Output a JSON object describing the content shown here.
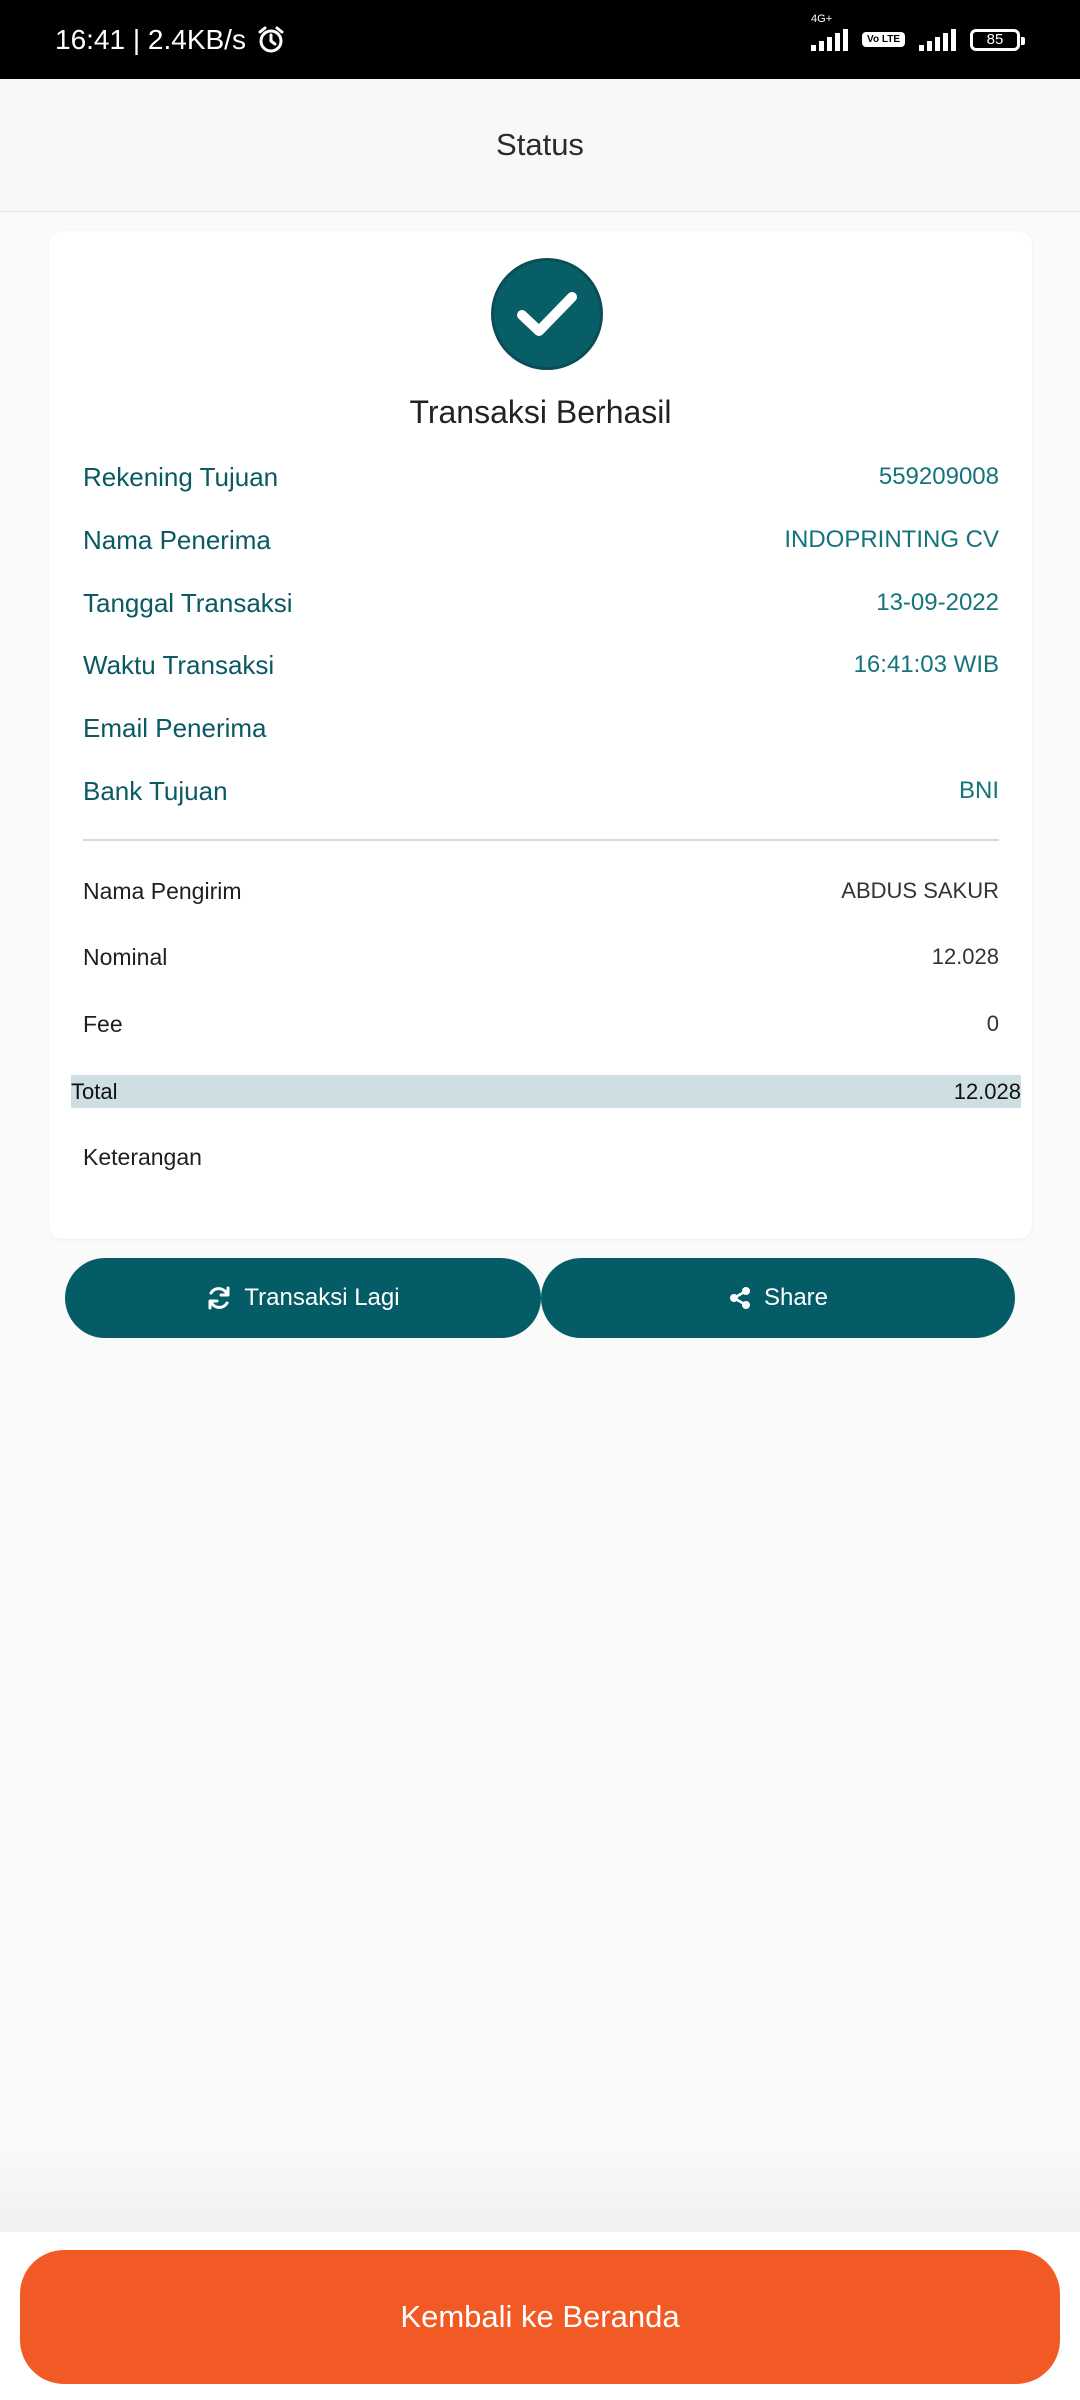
{
  "status_bar": {
    "time_speed": "16:41 | 2.4KB/s",
    "network_tiny": "4G+",
    "volte": "Vo LTE",
    "battery": "85"
  },
  "header": {
    "title": "Status"
  },
  "result": {
    "title": "Transaksi Berhasil",
    "details": [
      {
        "label": "Rekening Tujuan",
        "value": "559209008"
      },
      {
        "label": "Nama Penerima",
        "value": "INDOPRINTING CV"
      },
      {
        "label": "Tanggal Transaksi",
        "value": "13-09-2022"
      },
      {
        "label": "Waktu Transaksi",
        "value": "16:41:03 WIB"
      },
      {
        "label": "Email Penerima",
        "value": ""
      },
      {
        "label": "Bank Tujuan",
        "value": "BNI"
      }
    ],
    "summary": [
      {
        "label": "Nama Pengirim",
        "value": "ABDUS SAKUR"
      },
      {
        "label": "Nominal",
        "value": "12.028"
      },
      {
        "label": "Fee",
        "value": "0"
      },
      {
        "label": "Total",
        "value": "12.028"
      },
      {
        "label": "Keterangan",
        "value": ""
      }
    ]
  },
  "actions": {
    "retry_label": "Transaksi Lagi",
    "share_label": "Share"
  },
  "footer": {
    "home_label": "Kembali ke Beranda"
  },
  "colors": {
    "primary": "#045c66",
    "accent": "#f15a25",
    "total_highlight": "#cddfe2"
  }
}
